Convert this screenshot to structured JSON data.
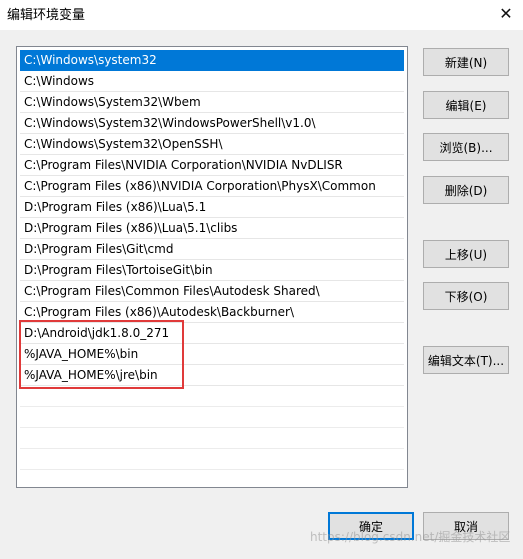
{
  "window": {
    "title": "编辑环境变量",
    "close_glyph": "✕"
  },
  "paths": [
    "C:\\Windows\\system32",
    "C:\\Windows",
    "C:\\Windows\\System32\\Wbem",
    "C:\\Windows\\System32\\WindowsPowerShell\\v1.0\\",
    "C:\\Windows\\System32\\OpenSSH\\",
    "C:\\Program Files\\NVIDIA Corporation\\NVIDIA NvDLISR",
    "C:\\Program Files (x86)\\NVIDIA Corporation\\PhysX\\Common",
    "D:\\Program Files (x86)\\Lua\\5.1",
    "D:\\Program Files (x86)\\Lua\\5.1\\clibs",
    "D:\\Program Files\\Git\\cmd",
    "D:\\Program Files\\TortoiseGit\\bin",
    "C:\\Program Files\\Common Files\\Autodesk Shared\\",
    "C:\\Program Files (x86)\\Autodesk\\Backburner\\",
    "D:\\Android\\jdk1.8.0_271",
    "%JAVA_HOME%\\bin",
    "%JAVA_HOME%\\jre\\bin"
  ],
  "selected_index": 0,
  "buttons": {
    "new": "新建(N)",
    "edit": "编辑(E)",
    "browse": "浏览(B)...",
    "delete": "删除(D)",
    "move_up": "上移(U)",
    "move_down": "下移(O)",
    "edit_text": "编辑文本(T)...",
    "ok": "确定",
    "cancel": "取消"
  },
  "watermark": "https://blog.csdn.net/掘金技术社区",
  "colors": {
    "selection": "#0078d7",
    "highlight_border": "#e03a3a"
  }
}
